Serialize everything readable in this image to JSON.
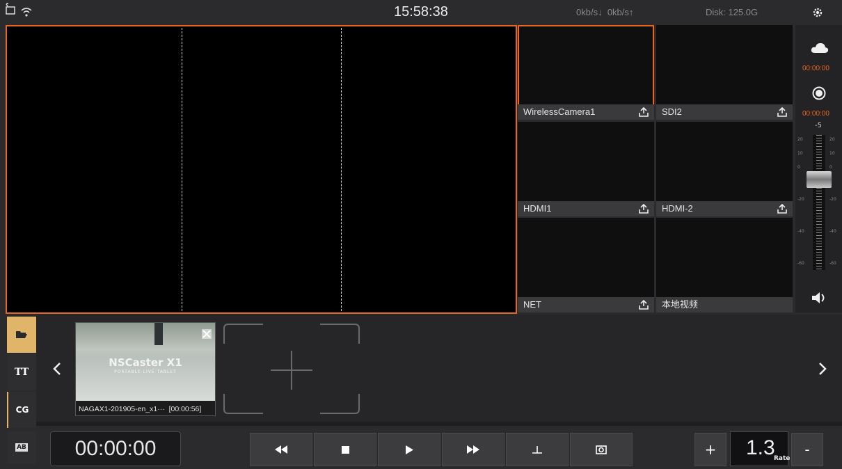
{
  "status": {
    "time": "15:58:38",
    "net_down": "0kb/s",
    "net_up": "0kb/s",
    "disk": "Disk:  125.0G",
    "down_arrow": "↓",
    "up_arrow": "↑"
  },
  "sources": [
    {
      "label": "WirelessCamera1"
    },
    {
      "label": "SDI2"
    },
    {
      "label": "HDMI1"
    },
    {
      "label": "HDMI-2"
    },
    {
      "label": "NET"
    },
    {
      "label": "本地视频"
    }
  ],
  "meter": {
    "stream_time": "00:00:00",
    "record_time": "00:00:00",
    "level_top": "-5",
    "scale": [
      "20",
      "10",
      "0",
      "-20",
      "-40",
      "-60"
    ],
    "scale_right": [
      "20",
      "10",
      "0",
      "-20",
      "-40",
      "-60"
    ]
  },
  "tabs": [
    {
      "label": ""
    },
    {
      "label": "TT"
    },
    {
      "label": "CG"
    },
    {
      "label": "AB"
    }
  ],
  "media": {
    "file_name": "NAGAX1-201905-en_x1···",
    "duration": "[00:00:56]",
    "thumb_title": "NSCaster X1",
    "thumb_sub": "PORTABLE LIVE TABLET"
  },
  "transport": {
    "timecode": "00:00:00",
    "rate_value": "1.3",
    "rate_label": "Rate",
    "plus": "+",
    "minus": "-"
  },
  "colors": {
    "accent": "#e8661f",
    "folder_tab": "#e0b56a"
  }
}
